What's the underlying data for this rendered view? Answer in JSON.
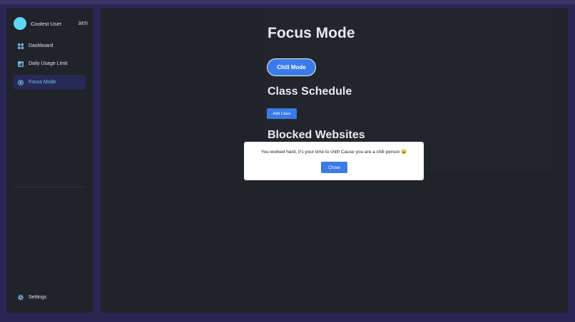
{
  "sidebar": {
    "user": {
      "name": "Coolest User",
      "glyph": "â€®"
    },
    "items": [
      {
        "label": "Dashboard",
        "icon": "dashboard-icon"
      },
      {
        "label": "Daily Usage Limit",
        "icon": "bar-chart-icon"
      },
      {
        "label": "Focus Mode",
        "icon": "focus-target-icon",
        "active": true
      }
    ],
    "settings": {
      "label": "Settings",
      "icon": "gear-icon"
    }
  },
  "main": {
    "title": "Focus Mode",
    "chill_button": "Chill Mode",
    "class_schedule_title": "Class Schedule",
    "add_class_button": "Add Class",
    "blocked_websites_title": "Blocked Websites"
  },
  "modal": {
    "message": "You worked hard, it's your time to chill! Cause you are a chill person 😄",
    "close_button": "Close"
  },
  "colors": {
    "accent": "#3b7be8",
    "active_text": "#74c6f0",
    "avatar": "#5fd6f5",
    "panel": "#20232a",
    "frame": "#2a2552"
  }
}
